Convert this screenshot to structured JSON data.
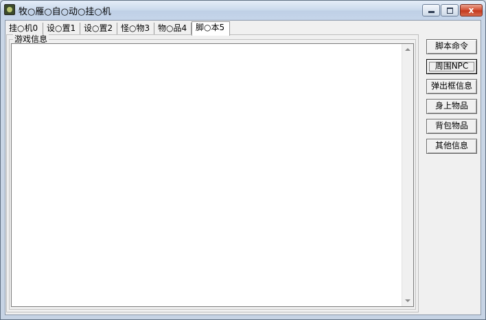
{
  "window": {
    "title": "牧○雁○自○动○挂○机",
    "close_glyph": "x"
  },
  "tabs": [
    {
      "label": "挂○机0"
    },
    {
      "label": "设○置1"
    },
    {
      "label": "设○置2"
    },
    {
      "label": "怪○物3"
    },
    {
      "label": "物○品4"
    },
    {
      "label": "脚○本5",
      "active": true
    }
  ],
  "panel": {
    "group_label": "游戏信息",
    "text_content": ""
  },
  "side_buttons": [
    {
      "label": "脚本命令"
    },
    {
      "label": "周围NPC"
    },
    {
      "label": "弹出框信息"
    },
    {
      "label": "身上物品"
    },
    {
      "label": "背包物品"
    },
    {
      "label": "其他信息"
    }
  ]
}
